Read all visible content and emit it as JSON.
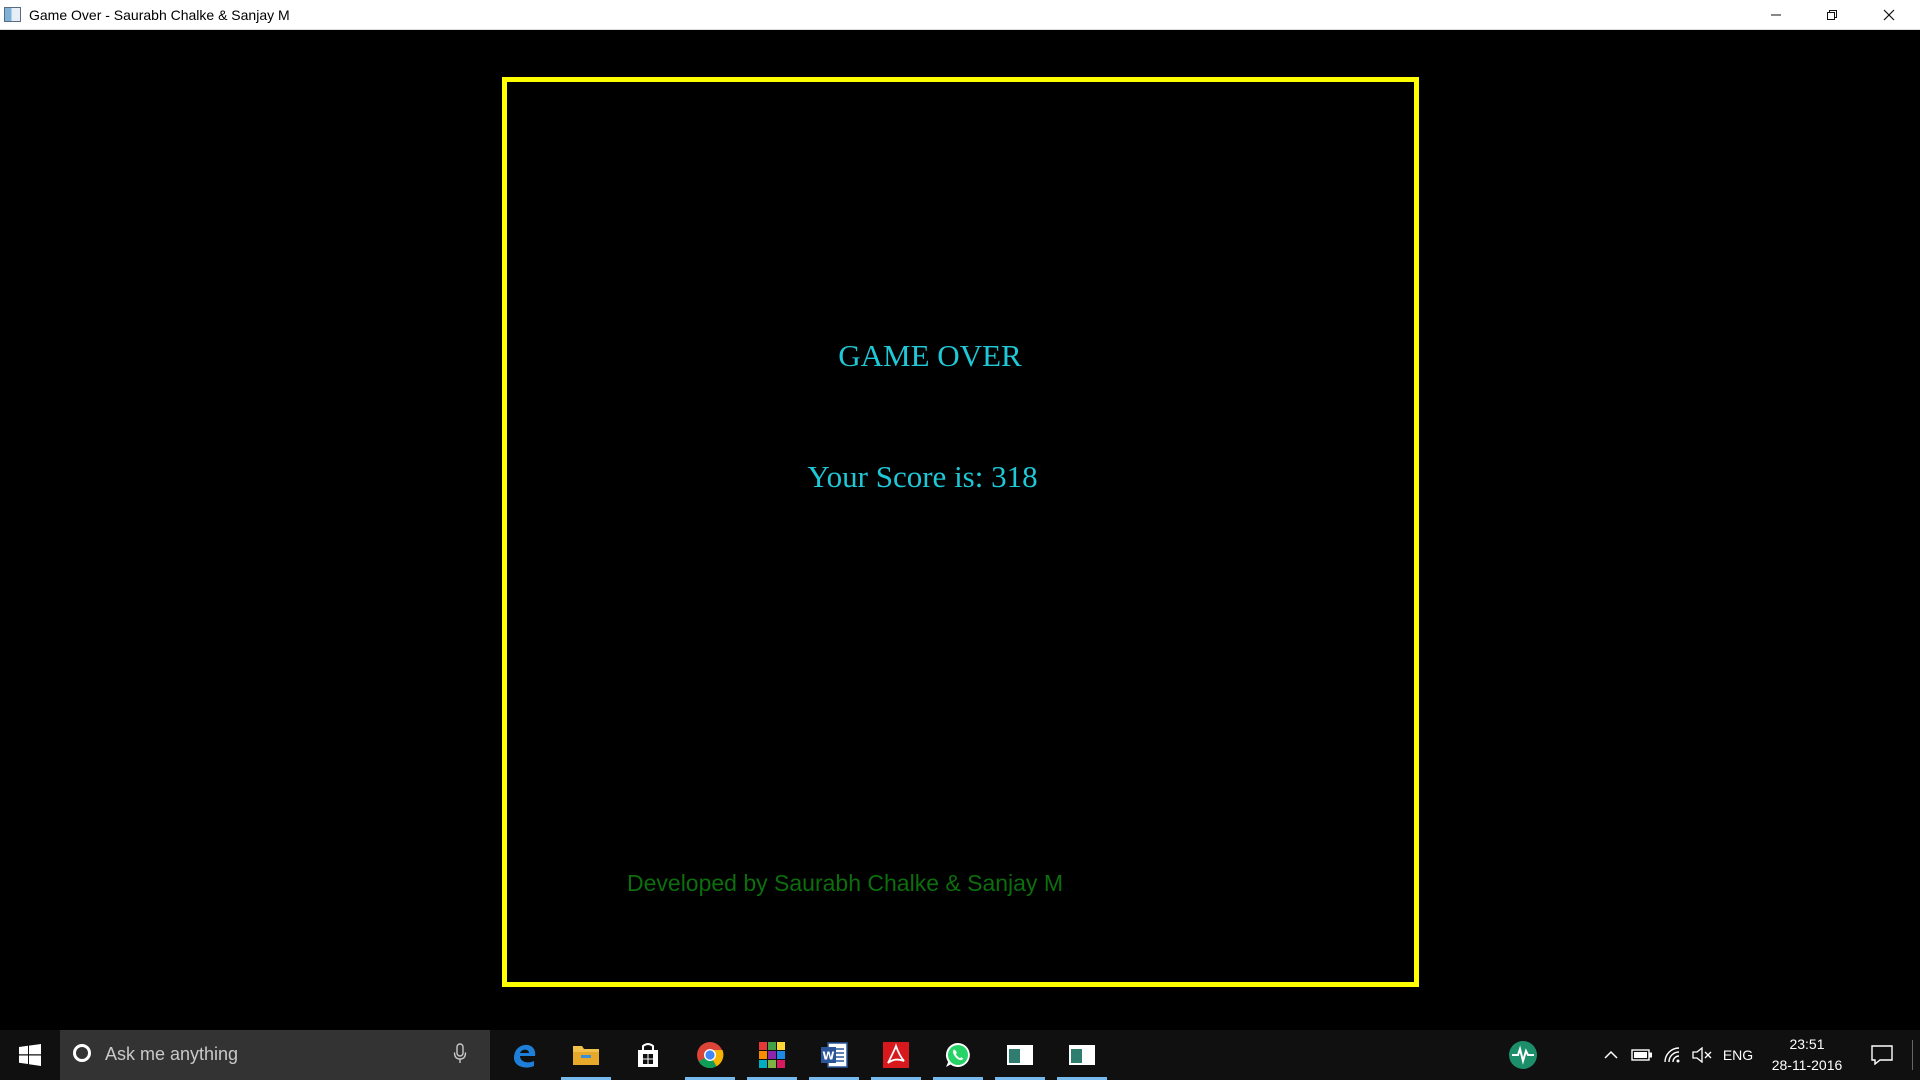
{
  "window": {
    "title": "Game Over - Saurabh Chalke & Sanjay M",
    "minimize_glyph": "—",
    "maximize_glyph": "❐",
    "close_glyph": "✕"
  },
  "game": {
    "title": "GAME OVER",
    "score_text": "Your Score is: 318",
    "credits": "Developed by Saurabh Chalke & Sanjay M",
    "colors": {
      "frame": "#ffff00",
      "title": "#1fc8d6",
      "credits": "#0c6e0c",
      "background": "#000000"
    }
  },
  "taskbar": {
    "search_placeholder": "Ask me anything",
    "pinned_apps": [
      {
        "name": "edge-icon"
      },
      {
        "name": "file-explorer-icon"
      },
      {
        "name": "store-icon"
      },
      {
        "name": "chrome-icon"
      },
      {
        "name": "colorful-app-icon"
      },
      {
        "name": "word-icon"
      },
      {
        "name": "acrobat-icon"
      },
      {
        "name": "whatsapp-icon"
      },
      {
        "name": "window-app-icon"
      },
      {
        "name": "window-app-icon"
      }
    ],
    "tray": {
      "language": "ENG",
      "time": "23:51",
      "date": "28-11-2016"
    }
  }
}
